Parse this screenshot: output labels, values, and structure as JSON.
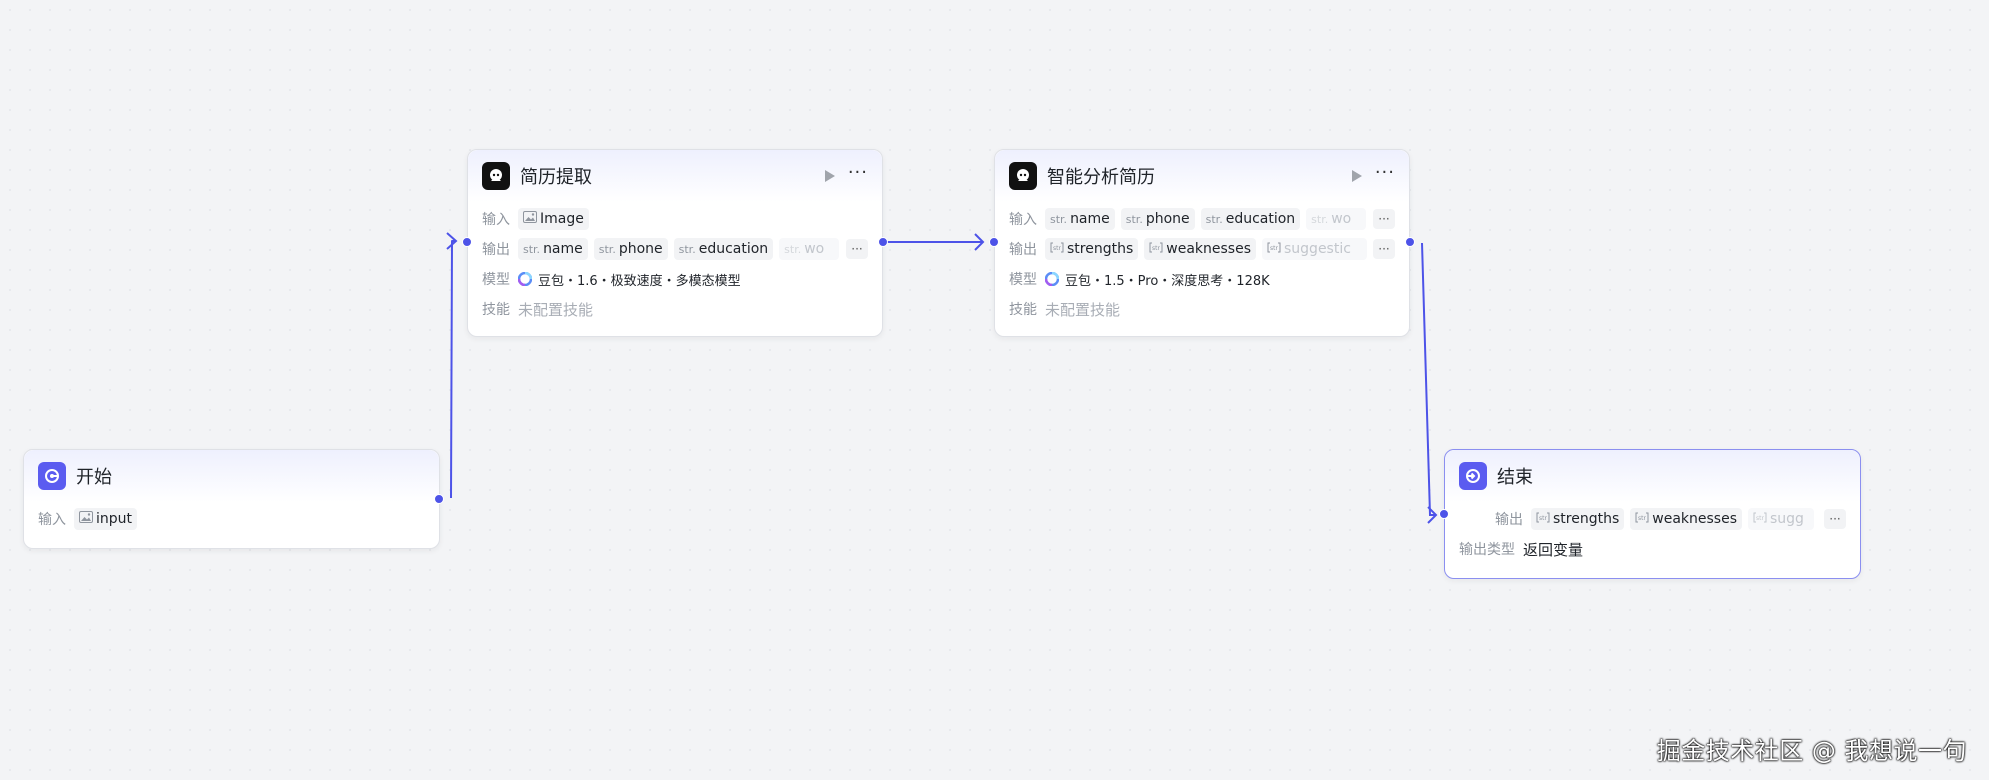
{
  "nodes": {
    "start": {
      "title": "开始",
      "input_label": "输入",
      "input_var": "input"
    },
    "extract": {
      "title": "简历提取",
      "input_label": "输入",
      "inputs": [
        "Image"
      ],
      "output_label": "输出",
      "outputs": [
        {
          "type": "str.",
          "name": "name"
        },
        {
          "type": "str.",
          "name": "phone"
        },
        {
          "type": "str.",
          "name": "education"
        },
        {
          "type": "str.",
          "name": "wo"
        }
      ],
      "model_label": "模型",
      "model": "豆包・1.6・极致速度・多模态模型",
      "skill_label": "技能",
      "skill": "未配置技能"
    },
    "analyze": {
      "title": "智能分析简历",
      "input_label": "输入",
      "inputs": [
        {
          "type": "str.",
          "name": "name"
        },
        {
          "type": "str.",
          "name": "phone"
        },
        {
          "type": "str.",
          "name": "education"
        },
        {
          "type": "str.",
          "name": "wo"
        }
      ],
      "output_label": "输出",
      "outputs": [
        {
          "name": "strengths"
        },
        {
          "name": "weaknesses"
        },
        {
          "name": "suggestic"
        }
      ],
      "model_label": "模型",
      "model": "豆包・1.5・Pro・深度思考・128K",
      "skill_label": "技能",
      "skill": "未配置技能"
    },
    "end": {
      "title": "结束",
      "output_label": "输出",
      "outputs": [
        {
          "name": "strengths"
        },
        {
          "name": "weaknesses"
        },
        {
          "name": "sugg"
        }
      ],
      "output_type_label": "输出类型",
      "output_type": "返回变量"
    }
  },
  "watermark": "掘金技术社区 @ 我想说一句",
  "colors": {
    "accent": "#4d53e8",
    "canvas": "#f3f4f6",
    "end_icon": "#5b5cf0"
  },
  "icons": {
    "start": "start-icon",
    "llm": "robot-icon",
    "end": "end-icon",
    "run": "play-icon",
    "more": "more-icon",
    "image": "image-icon",
    "array": "array-str-icon",
    "model": "doubao-logo-icon"
  }
}
